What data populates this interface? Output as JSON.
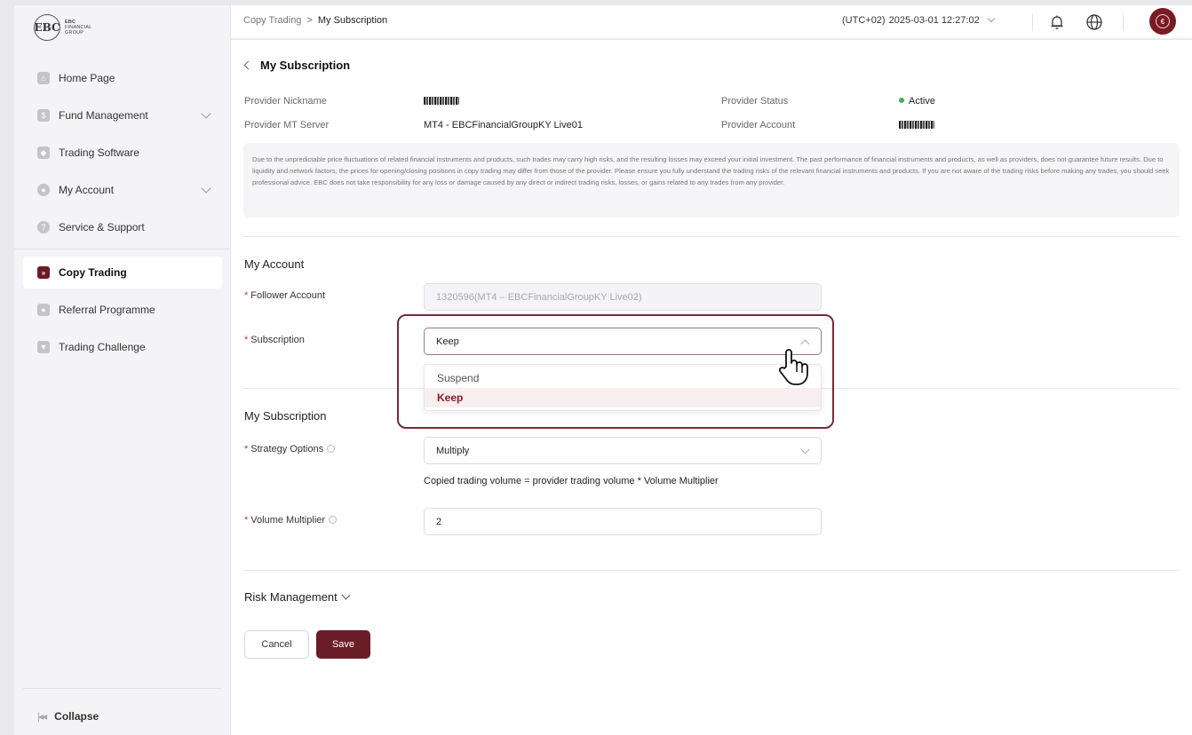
{
  "sidebar": {
    "logo": {
      "mark": "EBC",
      "line1": "EBC",
      "line2": "FINANCIAL",
      "line3": "GROUP"
    },
    "items": [
      {
        "label": "Home Page",
        "icon": "home-icon"
      },
      {
        "label": "Fund Management",
        "icon": "fund-icon",
        "expandable": true
      },
      {
        "label": "Trading Software",
        "icon": "software-icon"
      },
      {
        "label": "My Account",
        "icon": "account-icon",
        "expandable": true
      },
      {
        "label": "Service & Support",
        "icon": "support-icon"
      },
      {
        "label": "Copy Trading",
        "icon": "copy-trading-icon",
        "active": true
      },
      {
        "label": "Referral Programme",
        "icon": "referral-icon"
      },
      {
        "label": "Trading Challenge",
        "icon": "trophy-icon"
      }
    ],
    "collapse_label": "Collapse"
  },
  "topbar": {
    "breadcrumb": {
      "parent": "Copy Trading",
      "current": "My Subscription"
    },
    "timezone": "(UTC+02)",
    "datetime": "2025-03-01 12:27:02"
  },
  "page": {
    "title": "My Subscription",
    "provider": {
      "nickname_label": "Provider Nickname",
      "server_label": "Provider MT Server",
      "server_value": "MT4 - EBCFinancialGroupKY Live01",
      "status_label": "Provider Status",
      "status_value": "Active",
      "account_label": "Provider Account"
    },
    "disclaimer": "Due to the unpredictable price fluctuations of related financial instruments and products, such trades may carry high risks, and the resulting losses may exceed your initial investment. The past performance of financial instruments and products, as well as providers, does not guarantee future results. Due to liquidity and network factors, the prices for opening/closing positions in copy trading may differ from those of the provider. Please ensure you fully understand the trading risks of the relevant financial instruments and products. If you are not aware of the trading risks before making any trades, you should seek professional advice. EBC does not take responsibility for any loss or damage caused by any direct or indirect trading risks, losses, or gains related to any trades from any provider.",
    "my_account": {
      "section_title": "My Account",
      "follower_label": "Follower Account",
      "follower_value": "1320596(MT4 – EBCFinancialGroupKY Live02)",
      "subscription_label": "Subscription",
      "subscription_value": "Keep",
      "subscription_options": [
        "Suspend",
        "Keep"
      ]
    },
    "my_subscription": {
      "section_title": "My Subscription",
      "strategy_label": "Strategy Options",
      "strategy_value": "Multiply",
      "helper": "Copied trading volume = provider trading volume * Volume Multiplier",
      "multiplier_label": "Volume Multiplier",
      "multiplier_value": "2"
    },
    "risk_label": "Risk Management",
    "cancel_label": "Cancel",
    "save_label": "Save"
  },
  "colors": {
    "brand": "#6b1d28",
    "active_status": "#3ab54a",
    "selected_option": "#8a1c2b"
  }
}
